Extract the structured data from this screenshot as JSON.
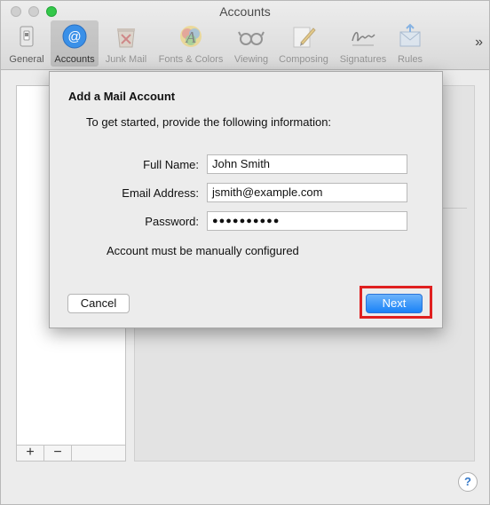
{
  "window": {
    "title": "Accounts"
  },
  "toolbar": {
    "items": [
      {
        "label": "General",
        "icon": "general-icon"
      },
      {
        "label": "Accounts",
        "icon": "at-sign-icon",
        "selected": true
      },
      {
        "label": "Junk Mail",
        "icon": "junk-mail-icon"
      },
      {
        "label": "Fonts & Colors",
        "icon": "fonts-colors-icon"
      },
      {
        "label": "Viewing",
        "icon": "glasses-icon"
      },
      {
        "label": "Composing",
        "icon": "pencil-icon"
      },
      {
        "label": "Signatures",
        "icon": "signature-icon"
      },
      {
        "label": "Rules",
        "icon": "rules-icon"
      }
    ],
    "overflow": "»"
  },
  "sheet": {
    "title": "Add a Mail Account",
    "intro": "To get started, provide the following information:",
    "fields": {
      "full_name": {
        "label": "Full Name:",
        "value": "John Smith"
      },
      "email": {
        "label": "Email Address:",
        "value": "jsmith@example.com"
      },
      "password": {
        "label": "Password:",
        "value": "●●●●●●●●●●"
      }
    },
    "note": "Account must be manually configured",
    "cancel_label": "Cancel",
    "next_label": "Next"
  },
  "list": {
    "add": "+",
    "remove": "−"
  },
  "help": "?",
  "colors": {
    "accent": "#1a82f7",
    "highlight": "#e02020",
    "zoom": "#34c84a"
  }
}
